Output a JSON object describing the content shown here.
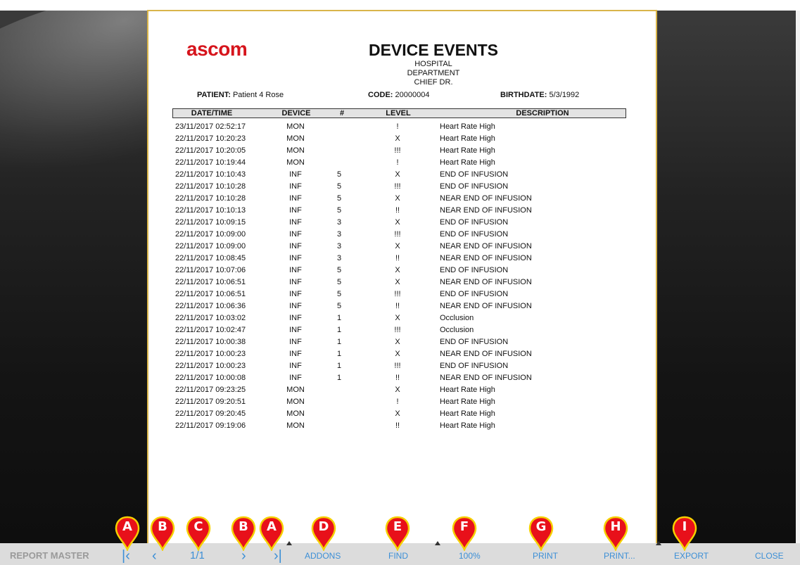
{
  "report": {
    "logo": "ascom",
    "title": "DEVICE EVENTS",
    "subtitle_lines": [
      "HOSPITAL",
      "DEPARTMENT",
      "CHIEF DR."
    ],
    "patient_label": "PATIENT:",
    "patient_value": "Patient 4 Rose",
    "code_label": "CODE:",
    "code_value": "20000004",
    "birthdate_label": "BIRTHDATE:",
    "birthdate_value": "5/3/1992",
    "columns": [
      "DATE/TIME",
      "DEVICE",
      "#",
      "LEVEL",
      "DESCRIPTION"
    ],
    "rows": [
      [
        "23/11/2017 02:52:17",
        "MON",
        "",
        "!",
        "Heart Rate High"
      ],
      [
        "22/11/2017 10:20:23",
        "MON",
        "",
        "X",
        "Heart Rate High"
      ],
      [
        "22/11/2017 10:20:05",
        "MON",
        "",
        "!!!",
        "Heart Rate High"
      ],
      [
        "22/11/2017 10:19:44",
        "MON",
        "",
        "!",
        "Heart Rate High"
      ],
      [
        "22/11/2017 10:10:43",
        "INF",
        "5",
        "X",
        "END OF INFUSION"
      ],
      [
        "22/11/2017 10:10:28",
        "INF",
        "5",
        "!!!",
        "END OF INFUSION"
      ],
      [
        "22/11/2017 10:10:28",
        "INF",
        "5",
        "X",
        "NEAR END OF INFUSION"
      ],
      [
        "22/11/2017 10:10:13",
        "INF",
        "5",
        "!!",
        "NEAR END OF INFUSION"
      ],
      [
        "22/11/2017 10:09:15",
        "INF",
        "3",
        "X",
        "END OF INFUSION"
      ],
      [
        "22/11/2017 10:09:00",
        "INF",
        "3",
        "!!!",
        "END OF INFUSION"
      ],
      [
        "22/11/2017 10:09:00",
        "INF",
        "3",
        "X",
        "NEAR END OF INFUSION"
      ],
      [
        "22/11/2017 10:08:45",
        "INF",
        "3",
        "!!",
        "NEAR END OF INFUSION"
      ],
      [
        "22/11/2017 10:07:06",
        "INF",
        "5",
        "X",
        "END OF INFUSION"
      ],
      [
        "22/11/2017 10:06:51",
        "INF",
        "5",
        "X",
        "NEAR END OF INFUSION"
      ],
      [
        "22/11/2017 10:06:51",
        "INF",
        "5",
        "!!!",
        "END OF INFUSION"
      ],
      [
        "22/11/2017 10:06:36",
        "INF",
        "5",
        "!!",
        "NEAR END OF INFUSION"
      ],
      [
        "22/11/2017 10:03:02",
        "INF",
        "1",
        "X",
        "Occlusion"
      ],
      [
        "22/11/2017 10:02:47",
        "INF",
        "1",
        "!!!",
        "Occlusion"
      ],
      [
        "22/11/2017 10:00:38",
        "INF",
        "1",
        "X",
        "END OF INFUSION"
      ],
      [
        "22/11/2017 10:00:23",
        "INF",
        "1",
        "X",
        "NEAR END OF INFUSION"
      ],
      [
        "22/11/2017 10:00:23",
        "INF",
        "1",
        "!!!",
        "END OF INFUSION"
      ],
      [
        "22/11/2017 10:00:08",
        "INF",
        "1",
        "!!",
        "NEAR END OF INFUSION"
      ],
      [
        "22/11/2017 09:23:25",
        "MON",
        "",
        "X",
        "Heart Rate High"
      ],
      [
        "22/11/2017 09:20:51",
        "MON",
        "",
        "!",
        "Heart Rate High"
      ],
      [
        "22/11/2017 09:20:45",
        "MON",
        "",
        "X",
        "Heart Rate High"
      ],
      [
        "22/11/2017 09:19:06",
        "MON",
        "",
        "!!",
        "Heart Rate High"
      ]
    ]
  },
  "toolbar": {
    "app_label": "REPORT MASTER",
    "first_icon": "first-page-icon",
    "prev_icon": "previous-page-icon",
    "page_indicator": "1/1",
    "next_icon": "next-page-icon",
    "last_icon": "last-page-icon",
    "addons": "ADDONS",
    "find": "FIND",
    "zoom": "100%",
    "print": "PRINT",
    "print_options": "PRINT...",
    "export": "EXPORT",
    "close": "CLOSE",
    "first_glyph": "|‹",
    "prev_glyph": "‹",
    "next_glyph": "›",
    "last_glyph": "›|"
  },
  "callouts": [
    "A",
    "B",
    "C",
    "B",
    "A",
    "D",
    "E",
    "F",
    "G",
    "H",
    "I"
  ],
  "colors": {
    "callout_red": "#e8101a",
    "callout_yellow": "#f5d000",
    "toolbar_link": "#3c8fd6",
    "logo_red": "#d6141c"
  }
}
